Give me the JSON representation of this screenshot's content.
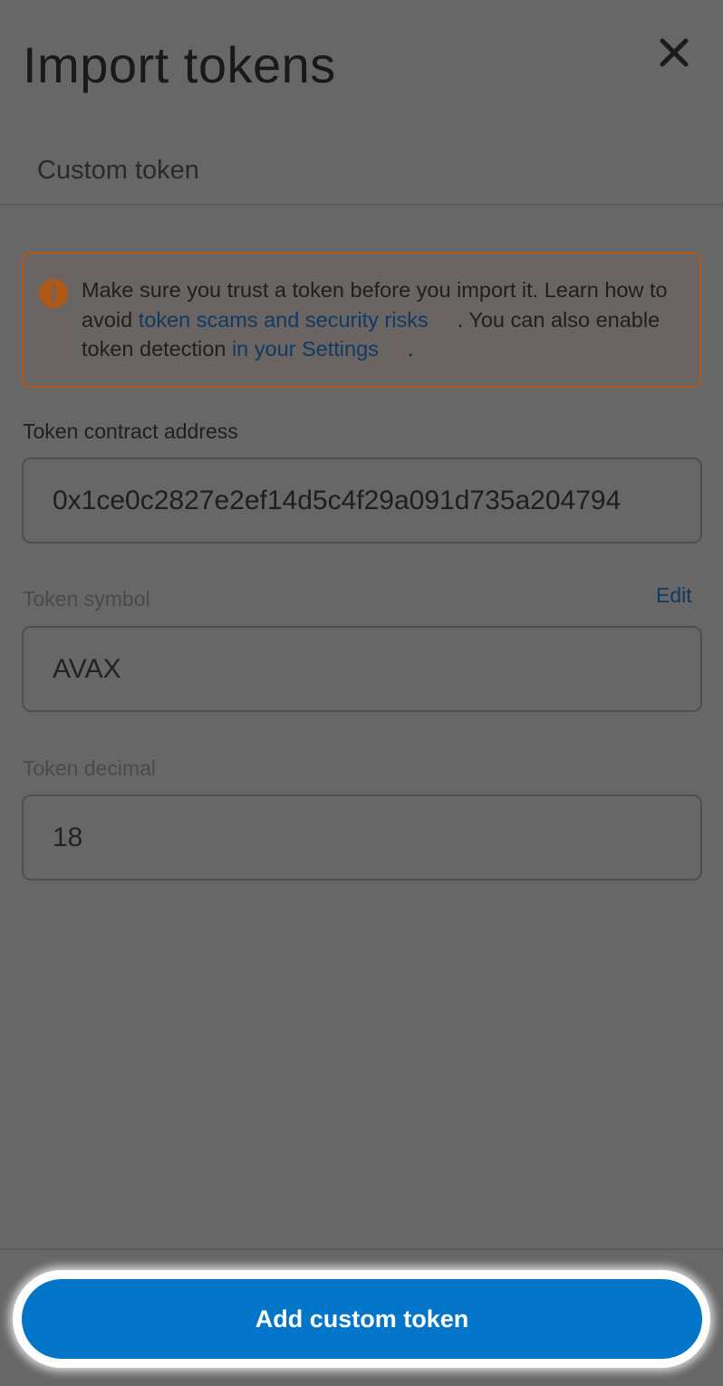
{
  "header": {
    "title": "Import tokens",
    "close_icon": "close-icon"
  },
  "tabs": [
    {
      "label": "Custom token"
    }
  ],
  "warning": {
    "icon": "info-icon",
    "text_1": "Make sure you trust a token before you import it. Learn how to avoid ",
    "link_1": "token scams and security risks",
    "text_2": ". You can also enable token detection ",
    "link_2": "in your Settings",
    "text_3": ".",
    "border_color": "#b05818",
    "icon_color": "#b05818"
  },
  "form": {
    "contract_address": {
      "label": "Token contract address",
      "value": "0x1ce0c2827e2ef14d5c4f29a091d735a204794"
    },
    "token_symbol": {
      "label": "Token symbol",
      "edit_label": "Edit",
      "value": "AVAX"
    },
    "token_decimal": {
      "label": "Token decimal",
      "value": "18"
    }
  },
  "footer": {
    "submit_label": "Add custom token",
    "button_color": "#0376c9"
  }
}
